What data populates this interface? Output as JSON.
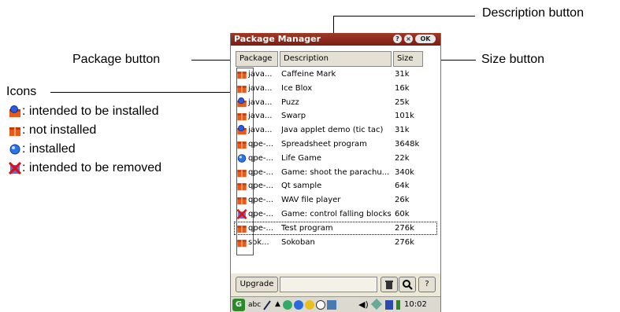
{
  "annotations": {
    "description_button": "Description button",
    "package_button": "Package button",
    "size_button": "Size button",
    "icons_title": "Icons",
    "legend": [
      {
        "icon": "package-with-blue-dot-icon",
        "text": ": intended to be installed"
      },
      {
        "icon": "package-icon",
        "text": ": not installed"
      },
      {
        "icon": "blue-ball-icon",
        "text": ": installed"
      },
      {
        "icon": "package-red-x-icon",
        "text": ": intended to be removed"
      }
    ]
  },
  "window": {
    "title": "Package Manager",
    "help_label": "?",
    "close_label": "×",
    "ok_label": "OK"
  },
  "columns": {
    "package": "Package",
    "description": "Description",
    "size": "Size"
  },
  "rows": [
    {
      "icon": "package-icon",
      "pkg": "java...",
      "desc": "Caffeine Mark",
      "size": "31k"
    },
    {
      "icon": "package-icon",
      "pkg": "java...",
      "desc": "Ice Blox",
      "size": "16k"
    },
    {
      "icon": "package-with-blue-dot-icon",
      "pkg": "java...",
      "desc": "Puzz",
      "size": "25k"
    },
    {
      "icon": "package-icon",
      "pkg": "java...",
      "desc": "Swarp",
      "size": "101k"
    },
    {
      "icon": "package-with-blue-dot-icon",
      "pkg": "java...",
      "desc": "Java applet demo (tic tac)",
      "size": "31k"
    },
    {
      "icon": "package-icon",
      "pkg": "qpe-...",
      "desc": "Spreadsheet program",
      "size": "3648k"
    },
    {
      "icon": "blue-ball-icon",
      "pkg": "qpe-...",
      "desc": "Life Game",
      "size": "22k"
    },
    {
      "icon": "package-icon",
      "pkg": "qpe-...",
      "desc": "Game: shoot the parachu...",
      "size": "340k"
    },
    {
      "icon": "package-icon",
      "pkg": "qpe-...",
      "desc": "Qt sample",
      "size": "64k"
    },
    {
      "icon": "package-icon",
      "pkg": "qpe-...",
      "desc": "WAV file player",
      "size": "26k"
    },
    {
      "icon": "package-red-x-icon",
      "pkg": "qpe-...",
      "desc": "Game: control falling blocks",
      "size": "60k"
    },
    {
      "icon": "package-icon",
      "pkg": "qpe-...",
      "desc": "Test program",
      "size": "276k",
      "selected": true
    },
    {
      "icon": "package-icon",
      "pkg": "sok...",
      "desc": "Sokoban",
      "size": "276k"
    }
  ],
  "bottom": {
    "upgrade_label": "Upgrade",
    "search_value": "",
    "help_label": "?"
  },
  "taskbar": {
    "input_label": "abc",
    "time": "10:02"
  }
}
